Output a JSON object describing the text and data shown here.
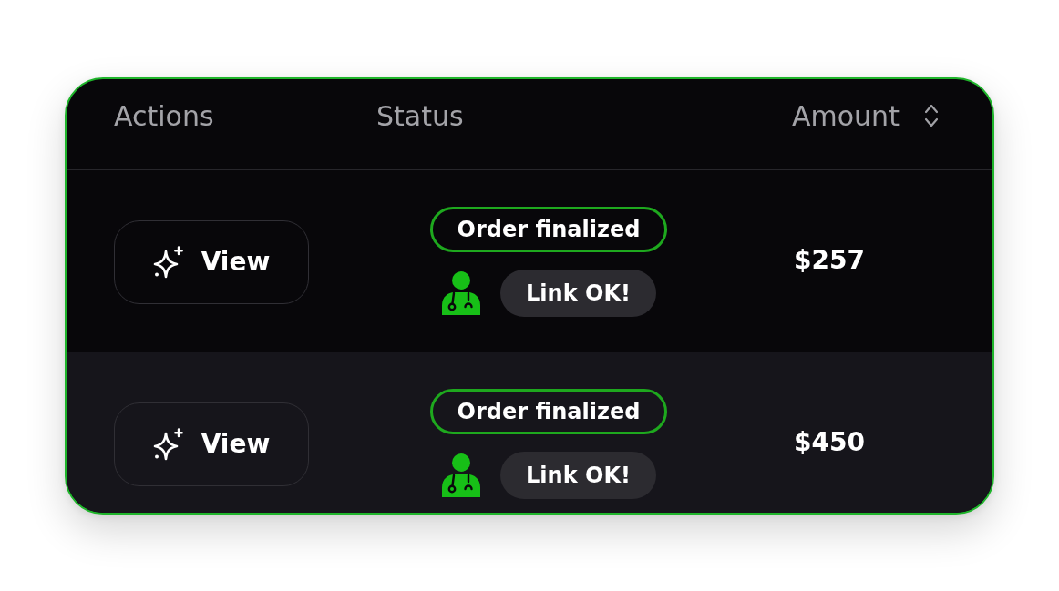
{
  "table": {
    "columns": [
      {
        "label": "Actions",
        "sortable": false
      },
      {
        "label": "Status",
        "sortable": false
      },
      {
        "label": "Amount",
        "sortable": true
      }
    ],
    "rows": [
      {
        "highlighted": false,
        "action": "View",
        "status": "Order finalized",
        "link": "Link OK!",
        "amount": "$257"
      },
      {
        "highlighted": true,
        "action": "View",
        "status": "Order finalized",
        "link": "Link OK!",
        "amount": "$450"
      }
    ]
  }
}
